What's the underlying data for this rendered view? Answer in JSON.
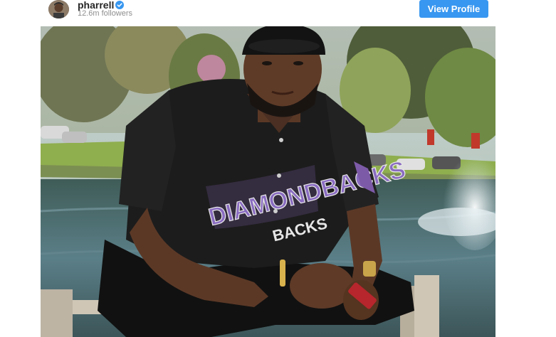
{
  "profile": {
    "username": "pharrell",
    "followers": "12.6m followers",
    "verified": true
  },
  "actions": {
    "view_profile_label": "View Profile"
  },
  "photo": {
    "jersey_text_line1": "DIAMONDBACKS",
    "jersey_text_line2": "BACKS"
  },
  "colors": {
    "button_blue": "#3897f0",
    "verified_blue": "#3897f0"
  }
}
